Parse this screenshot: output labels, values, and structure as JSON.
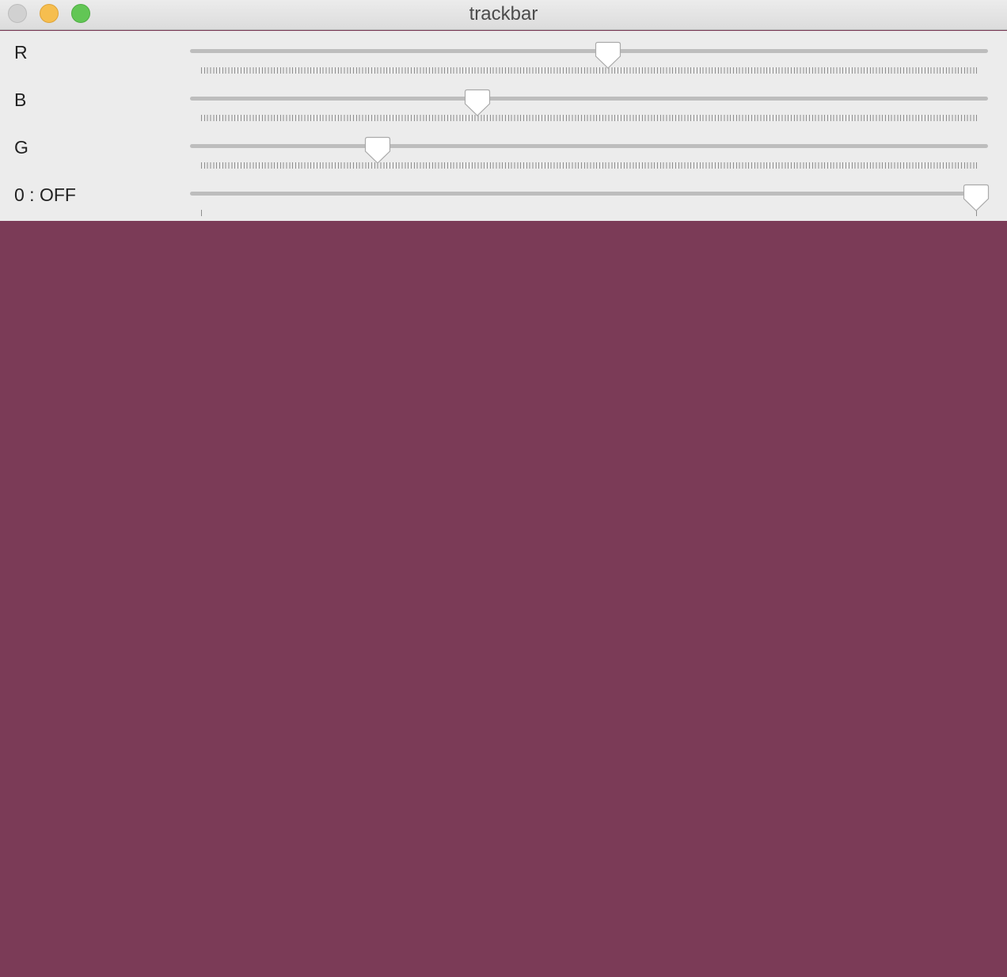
{
  "window": {
    "title": "trackbar"
  },
  "trackbars": [
    {
      "label": "R",
      "value": 134,
      "max": 255
    },
    {
      "label": "B",
      "value": 91,
      "max": 255
    },
    {
      "label": "G",
      "value": 58,
      "max": 255
    },
    {
      "label": "0 : OFF",
      "value": 1,
      "max": 1
    }
  ],
  "preview": {
    "color": "#7b3b57"
  }
}
